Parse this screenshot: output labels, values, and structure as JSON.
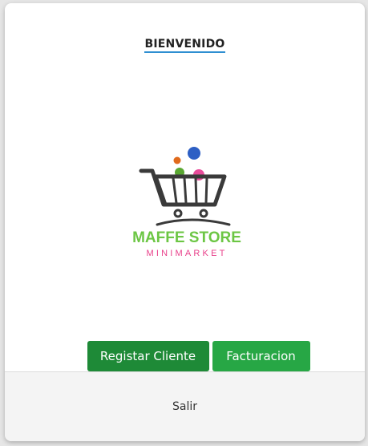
{
  "header": {
    "title": "BIENVENIDO"
  },
  "logo": {
    "brand": "MAFFE STORE",
    "subtitle": "MINIMARKET",
    "icon": "shopping-cart-icon",
    "colors": {
      "brand_green": "#6cc644",
      "subtitle_pink": "#e8408a",
      "cart": "#3a3a3a",
      "ball_blue": "#2d5fc4",
      "ball_orange": "#e06a1c",
      "ball_green": "#5aa832",
      "ball_pink": "#e84c9b"
    }
  },
  "actions": {
    "register_label": "Registar Cliente",
    "billing_label": "Facturacion"
  },
  "footer": {
    "exit_label": "Salir"
  },
  "theme": {
    "register_color": "#1e8a37",
    "billing_color": "#27a745",
    "title_underline": "#2f8fd1"
  }
}
